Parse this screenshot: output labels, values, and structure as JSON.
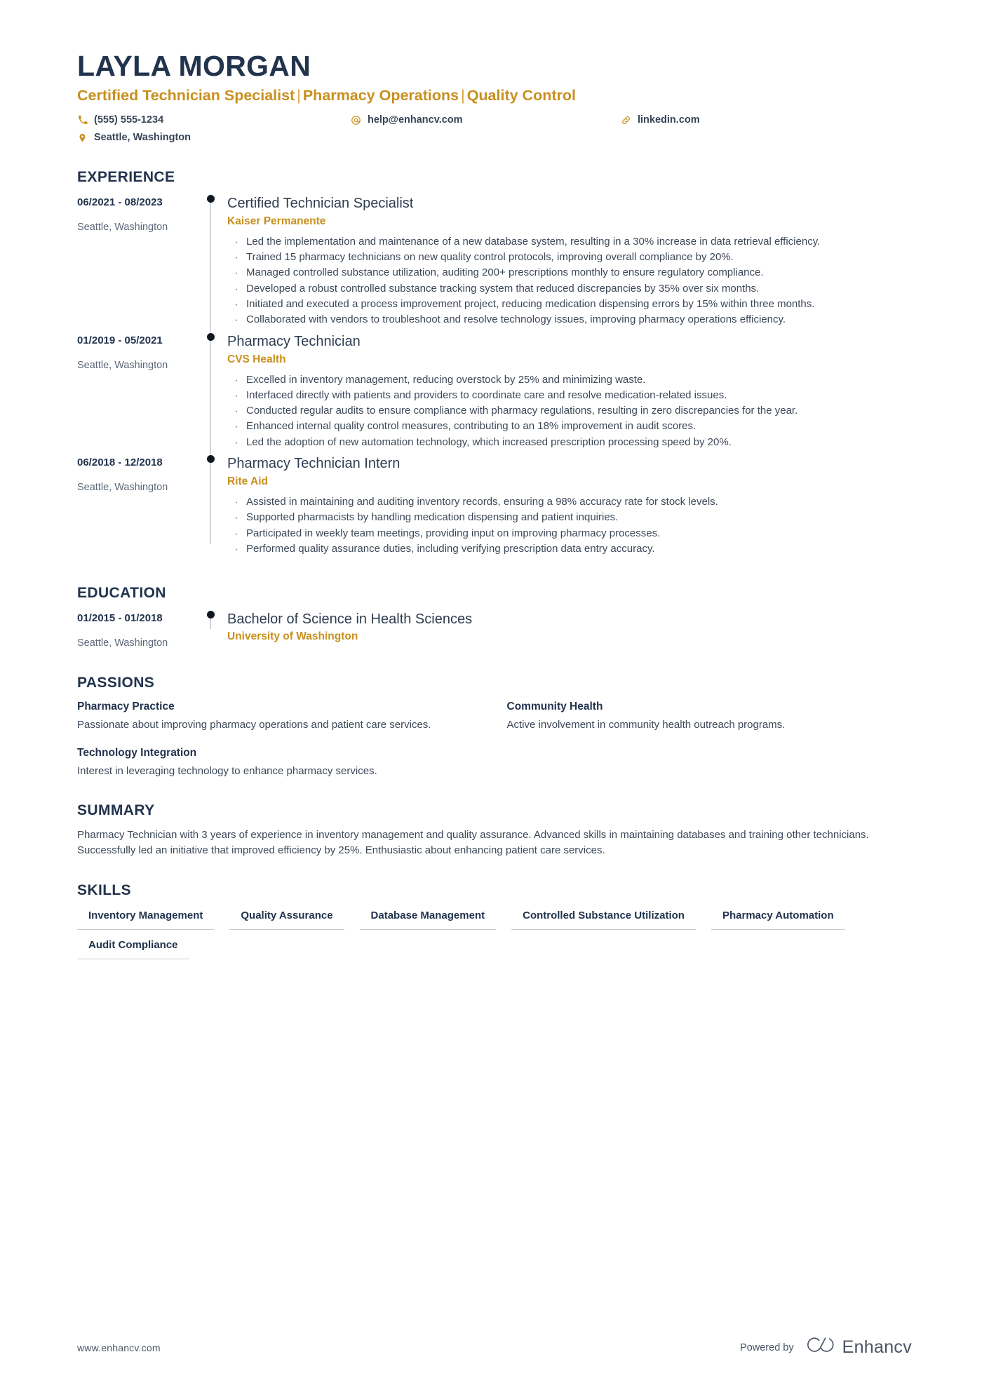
{
  "header": {
    "name": "LAYLA MORGAN",
    "headline_parts": [
      "Certified Technician Specialist",
      "Pharmacy Operations",
      "Quality Control"
    ],
    "headline_separator": "|",
    "contacts": [
      {
        "icon": "phone-icon",
        "text": "(555) 555-1234"
      },
      {
        "icon": "email-icon",
        "text": "help@enhancv.com"
      },
      {
        "icon": "link-icon",
        "text": "linkedin.com"
      },
      {
        "icon": "location-pin-icon",
        "text": "Seattle, Washington"
      }
    ]
  },
  "experience": {
    "title": "EXPERIENCE",
    "entries": [
      {
        "date": "06/2021 - 08/2023",
        "location": "Seattle, Washington",
        "role": "Certified Technician Specialist",
        "company": "Kaiser Permanente",
        "bullets": [
          "Led the implementation and maintenance of a new database system, resulting in a 30% increase in data retrieval efficiency.",
          "Trained 15 pharmacy technicians on new quality control protocols, improving overall compliance by 20%.",
          "Managed controlled substance utilization, auditing 200+ prescriptions monthly to ensure regulatory compliance.",
          "Developed a robust controlled substance tracking system that reduced discrepancies by 35% over six months.",
          "Initiated and executed a process improvement project, reducing medication dispensing errors by 15% within three months.",
          "Collaborated with vendors to troubleshoot and resolve technology issues, improving pharmacy operations efficiency."
        ]
      },
      {
        "date": "01/2019 - 05/2021",
        "location": "Seattle, Washington",
        "role": "Pharmacy Technician",
        "company": "CVS Health",
        "bullets": [
          "Excelled in inventory management, reducing overstock by 25% and minimizing waste.",
          "Interfaced directly with patients and providers to coordinate care and resolve medication-related issues.",
          "Conducted regular audits to ensure compliance with pharmacy regulations, resulting in zero discrepancies for the year.",
          "Enhanced internal quality control measures, contributing to an 18% improvement in audit scores.",
          "Led the adoption of new automation technology, which increased prescription processing speed by 20%."
        ]
      },
      {
        "date": "06/2018 - 12/2018",
        "location": "Seattle, Washington",
        "role": "Pharmacy Technician Intern",
        "company": "Rite Aid",
        "bullets": [
          "Assisted in maintaining and auditing inventory records, ensuring a 98% accuracy rate for stock levels.",
          "Supported pharmacists by handling medication dispensing and patient inquiries.",
          "Participated in weekly team meetings, providing input on improving pharmacy processes.",
          "Performed quality assurance duties, including verifying prescription data entry accuracy."
        ]
      }
    ]
  },
  "education": {
    "title": "EDUCATION",
    "entries": [
      {
        "date": "01/2015 - 01/2018",
        "location": "Seattle, Washington",
        "degree": "Bachelor of Science in Health Sciences",
        "school": "University of Washington"
      }
    ]
  },
  "passions": {
    "title": "PASSIONS",
    "items": [
      {
        "name": "Pharmacy Practice",
        "description": "Passionate about improving pharmacy operations and patient care services."
      },
      {
        "name": "Community Health",
        "description": "Active involvement in community health outreach programs."
      },
      {
        "name": "Technology Integration",
        "description": "Interest in leveraging technology to enhance pharmacy services."
      }
    ]
  },
  "summary": {
    "title": "SUMMARY",
    "text": "Pharmacy Technician with 3 years of experience in inventory management and quality assurance. Advanced skills in maintaining databases and training other technicians. Successfully led an initiative that improved efficiency by 25%. Enthusiastic about enhancing patient care services."
  },
  "skills": {
    "title": "SKILLS",
    "items": [
      "Inventory Management",
      "Quality Assurance",
      "Database Management",
      "Controlled Substance Utilization",
      "Pharmacy Automation",
      "Audit Compliance"
    ]
  },
  "footer": {
    "url": "www.enhancv.com",
    "powered_by": "Powered by",
    "brand": "Enhancv"
  },
  "colors": {
    "accent_gold": "#c8901f",
    "navy": "#22334d",
    "body_text": "#3c4858",
    "muted": "#5c6878",
    "rail": "#cfd4da"
  }
}
